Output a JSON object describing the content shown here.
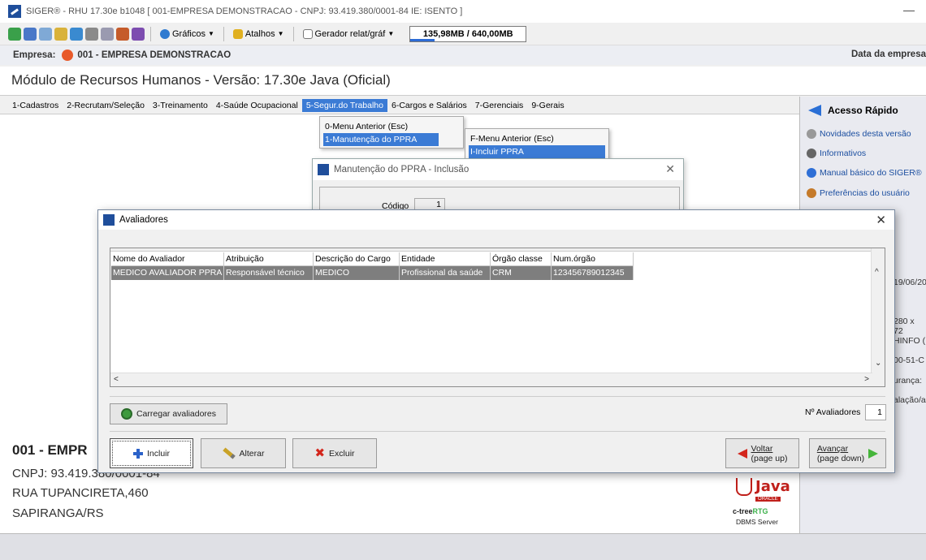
{
  "window": {
    "title": "SIGER® - RHU 17.30e b1048 [ 001-EMPRESA DEMONSTRACAO - CNPJ: 93.419.380/0001-84 IE: ISENTO ]",
    "minimize": "—"
  },
  "toolbar": {
    "graficos": "Gráficos",
    "atalhos": "Atalhos",
    "gerador": "Gerador relat/gráf",
    "memory": "135,98MB / 640,00MB",
    "memory_fraction": 0.21
  },
  "company_bar": {
    "label": "Empresa:",
    "name": "001 - EMPRESA DEMONSTRACAO",
    "right": "Data da empresa"
  },
  "module_title": "Módulo de Recursos Humanos - Versão: 17.30e Java (Oficial)",
  "menu": [
    "1-Cadastros",
    "2-Recrutam/Seleção",
    "3-Treinamento",
    "4-Saúde Ocupacional",
    "5-Segur.do Trabalho",
    "6-Cargos e Salários",
    "7-Gerenciais",
    "9-Gerais"
  ],
  "dropdown1": [
    "0-Menu Anterior (Esc)",
    "1-Manutenção do PPRA"
  ],
  "dropdown2": [
    "F-Menu Anterior (Esc)",
    "I-Incluir PPRA"
  ],
  "ppra_dialog": {
    "title": "Manutenção do PPRA - Inclusão",
    "codigo_label": "Código",
    "codigo_value": "1"
  },
  "right_panel": {
    "header": "Acesso Rápido",
    "items": [
      "Novidades desta versão",
      "Informativos",
      "Manual básico do SIGER®",
      "Preferências do usuário"
    ],
    "truncated": [
      "19/06/20",
      "280 x 72",
      "HINFO (",
      "00-51-C",
      "urança:",
      "alação/a"
    ]
  },
  "company_info": {
    "name": "001 - EMPR",
    "cnpj": "CNPJ: 93.419.380/0001-84",
    "address": "RUA TUPANCIRETA,460",
    "city": "SAPIRANGA/RS"
  },
  "java_logo": {
    "java": "Java",
    "oracle": "ORACLE",
    "ctree": "c-tree",
    "rtg": "RTG",
    "dbms": "DBMS Server"
  },
  "avaliadores": {
    "title": "Avaliadores",
    "close": "✕",
    "columns": [
      "Nome do Avaliador",
      "Atribuição",
      "Descrição do Cargo",
      "Entidade",
      "Órgão classe",
      "Num.órgão"
    ],
    "rows": [
      [
        "MEDICO AVALIADOR PPRA",
        "Responsável técnico",
        "MEDICO",
        "Profissional da saúde",
        "CRM",
        "123456789012345"
      ]
    ],
    "carregar": "Carregar avaliadores",
    "count_label": "Nº Avaliadores",
    "count_value": "1",
    "incluir": "Incluir",
    "alterar": "Alterar",
    "excluir": "Excluir",
    "voltar": "Voltar",
    "voltar_sub": "(page up)",
    "avancar": "Avançar",
    "avancar_sub": "(page down)"
  }
}
